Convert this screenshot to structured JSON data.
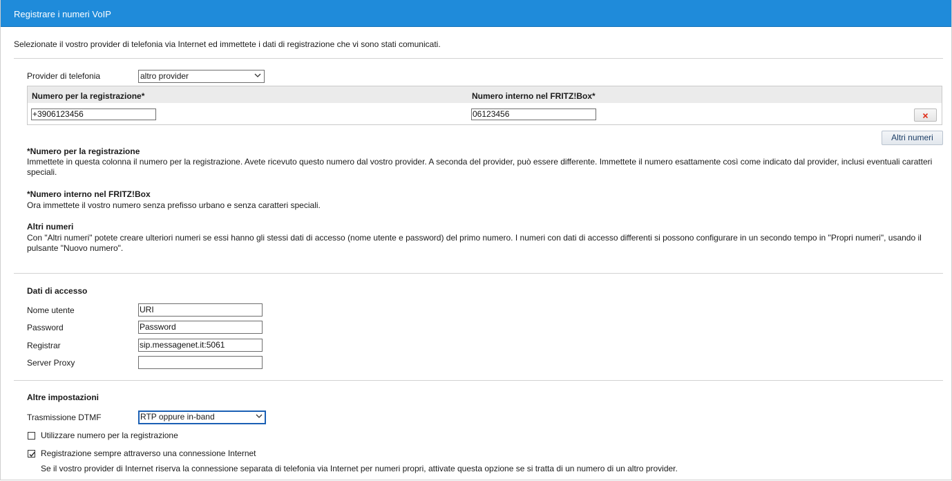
{
  "window": {
    "title": "Registrare i numeri VoIP"
  },
  "intro": "Selezionate il vostro provider di telefonia via Internet ed immettete i dati di registrazione che vi sono stati comunicati.",
  "provider": {
    "label": "Provider di telefonia",
    "selected": "altro provider"
  },
  "numbers_table": {
    "col_registration": "Numero per la registrazione*",
    "col_internal": "Numero interno nel FRITZ!Box*",
    "rows": [
      {
        "registration": "+3906123456",
        "internal": "06123456"
      }
    ]
  },
  "more_numbers_button": "Altri numeri",
  "help": {
    "reg_title": "*Numero per la registrazione",
    "reg_text": "Immettete in questa colonna il numero per la registrazione. Avete ricevuto questo numero dal vostro provider. A seconda del provider, può essere differente. Immettete il numero esattamente così come indicato dal provider, inclusi eventuali caratteri speciali.",
    "internal_title": "*Numero interno nel FRITZ!Box",
    "internal_text": "Ora immettete il vostro numero senza prefisso urbano e senza caratteri speciali.",
    "more_title": "Altri numeri",
    "more_text": "Con \"Altri numeri\" potete creare ulteriori numeri se essi hanno gli stessi dati di accesso (nome utente e password) del primo numero. I numeri con dati di accesso differenti si possono configurare in un secondo tempo in \"Propri numeri\", usando il pulsante \"Nuovo numero\"."
  },
  "access": {
    "title": "Dati di accesso",
    "username_label": "Nome utente",
    "username": "URI",
    "password_label": "Password",
    "password": "Password",
    "registrar_label": "Registrar",
    "registrar": "sip.messagenet.it:5061",
    "proxy_label": "Server Proxy",
    "proxy": ""
  },
  "other": {
    "title": "Altre impostazioni",
    "dtmf_label": "Trasmissione DTMF",
    "dtmf_selected": "RTP oppure in-band",
    "use_reg_number_label": "Utilizzare numero per la registrazione",
    "use_reg_number_checked": false,
    "always_internet_label": "Registrazione sempre attraverso una connessione Internet",
    "always_internet_checked": true,
    "always_internet_note": "Se il vostro provider di Internet riserva la connessione separata di telefonia via Internet per numeri propri, attivate questa opzione se si tratta di un numero di un altro provider."
  },
  "colors": {
    "titlebar": "#1f8bda",
    "delete_x": "#e0321e"
  }
}
